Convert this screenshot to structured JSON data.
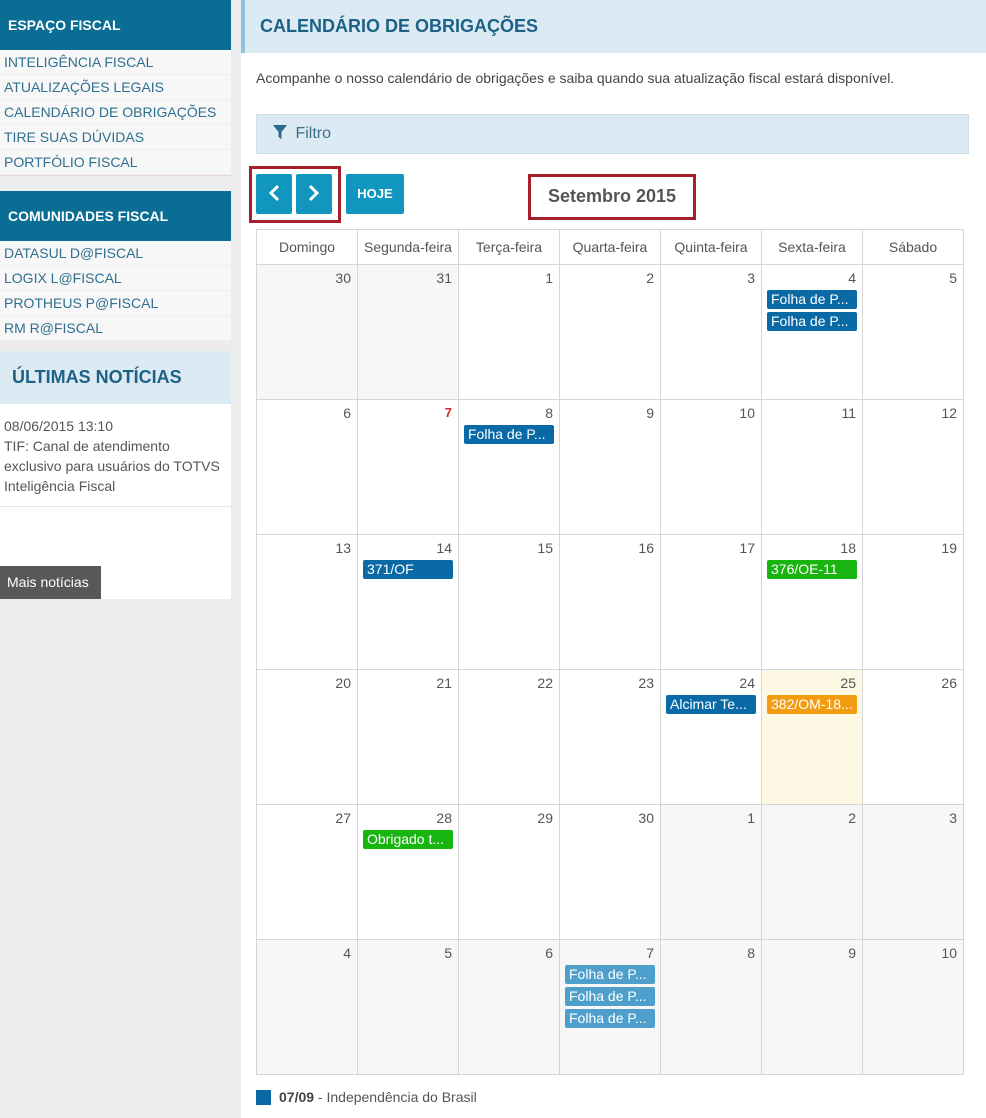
{
  "sidebar": {
    "fiscal_title": "ESPAÇO FISCAL",
    "fiscal_items": [
      "INTELIGÊNCIA FISCAL",
      "ATUALIZAÇÕES LEGAIS",
      "CALENDÁRIO DE OBRIGAÇÕES",
      "TIRE SUAS DÚVIDAS",
      "PORTFÓLIO FISCAL"
    ],
    "communities_title": "COMUNIDADES FISCAL",
    "community_items": [
      "DATASUL D@FISCAL",
      "LOGIX L@FISCAL",
      "PROTHEUS P@FISCAL",
      "RM R@FISCAL"
    ],
    "news_title": "ÚLTIMAS NOTÍCIAS",
    "news": [
      {
        "date": "08/06/2015 13:10",
        "text": "TIF: Canal de atendimento exclusivo para usuários do TOTVS Inteligência Fiscal"
      }
    ],
    "more_news": "Mais notícias"
  },
  "main": {
    "title": "CALENDÁRIO DE OBRIGAÇÕES",
    "intro": "Acompanhe o nosso calendário de obrigações e saiba quando sua atualização fiscal estará disponível.",
    "filter_label": "Filtro",
    "today_label": "HOJE",
    "month_title": "Setembro 2015"
  },
  "calendar": {
    "weekdays": [
      "Domingo",
      "Segunda-feira",
      "Terça-feira",
      "Quarta-feira",
      "Quinta-feira",
      "Sexta-feira",
      "Sábado"
    ],
    "weeks": [
      [
        {
          "d": "30",
          "other": true
        },
        {
          "d": "31",
          "other": true
        },
        {
          "d": "1"
        },
        {
          "d": "2"
        },
        {
          "d": "3"
        },
        {
          "d": "4",
          "events": [
            {
              "t": "Folha de P...",
              "c": "blue"
            },
            {
              "t": "Folha de P...",
              "c": "blue"
            }
          ]
        },
        {
          "d": "5"
        }
      ],
      [
        {
          "d": "6"
        },
        {
          "d": "7",
          "red": true
        },
        {
          "d": "8",
          "events": [
            {
              "t": "Folha de P...",
              "c": "blue"
            }
          ]
        },
        {
          "d": "9"
        },
        {
          "d": "10"
        },
        {
          "d": "11"
        },
        {
          "d": "12"
        }
      ],
      [
        {
          "d": "13"
        },
        {
          "d": "14",
          "events": [
            {
              "t": "371/OF",
              "c": "blue"
            }
          ]
        },
        {
          "d": "15"
        },
        {
          "d": "16"
        },
        {
          "d": "17"
        },
        {
          "d": "18",
          "events": [
            {
              "t": "376/OE-11",
              "c": "green"
            }
          ]
        },
        {
          "d": "19"
        }
      ],
      [
        {
          "d": "20"
        },
        {
          "d": "21"
        },
        {
          "d": "22"
        },
        {
          "d": "23"
        },
        {
          "d": "24",
          "events": [
            {
              "t": "Alcimar Te...",
              "c": "blue"
            }
          ]
        },
        {
          "d": "25",
          "today": true,
          "events": [
            {
              "t": "382/OM-18...",
              "c": "orange"
            }
          ]
        },
        {
          "d": "26"
        }
      ],
      [
        {
          "d": "27"
        },
        {
          "d": "28",
          "events": [
            {
              "t": "Obrigado t...",
              "c": "green"
            }
          ]
        },
        {
          "d": "29"
        },
        {
          "d": "30"
        },
        {
          "d": "1",
          "other": true
        },
        {
          "d": "2",
          "other": true
        },
        {
          "d": "3",
          "other": true
        }
      ],
      [
        {
          "d": "4",
          "other": true
        },
        {
          "d": "5",
          "other": true
        },
        {
          "d": "6",
          "other": true
        },
        {
          "d": "7",
          "other": true,
          "events": [
            {
              "t": "Folha de P...",
              "c": "lightblue"
            },
            {
              "t": "Folha de P...",
              "c": "lightblue"
            },
            {
              "t": "Folha de P...",
              "c": "lightblue"
            }
          ]
        },
        {
          "d": "8",
          "other": true
        },
        {
          "d": "9",
          "other": true
        },
        {
          "d": "10",
          "other": true
        }
      ]
    ],
    "colors": {
      "blue": "#0a6aa6",
      "green": "#18b40f",
      "orange": "#f39c12",
      "lightblue": "#4f9fcd"
    }
  },
  "legend": {
    "date": "07/09",
    "text": " - Independência do Brasil",
    "color": "#0a6aa6"
  }
}
